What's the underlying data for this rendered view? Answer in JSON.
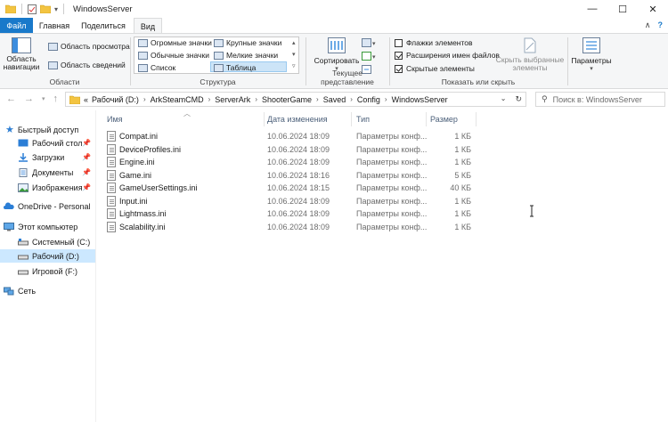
{
  "window": {
    "title": "WindowsServer",
    "controls": {
      "minimize": "—",
      "maximize": "☐",
      "close": "✕"
    }
  },
  "tabs": [
    {
      "label": "Файл"
    },
    {
      "label": "Главная"
    },
    {
      "label": "Поделиться"
    },
    {
      "label": "Вид"
    }
  ],
  "ribbon": {
    "panes": {
      "nav_pane": "Область навигации",
      "preview_pane": "Область просмотра",
      "details_pane": "Область сведений",
      "label": "Области"
    },
    "layout": {
      "label": "Структура",
      "items": [
        "Огромные значки",
        "Крупные значки",
        "Обычные значки",
        "Мелкие значки",
        "Список",
        "Таблица"
      ],
      "selected": "Таблица"
    },
    "current_view": {
      "sort": "Сортировать",
      "label": "Текущее представление"
    },
    "show_hide": {
      "label": "Показать или скрыть",
      "checkboxes": [
        {
          "label": "Флажки элементов",
          "checked": false
        },
        {
          "label": "Расширения имен файлов",
          "checked": true
        },
        {
          "label": "Скрытые элементы",
          "checked": true
        }
      ],
      "hide_selected": "Скрыть выбранные элементы"
    },
    "options": {
      "label": "Параметры"
    }
  },
  "address": {
    "prefix": "«",
    "crumbs": [
      "Рабочий (D:)",
      "ArkSteamCMD",
      "ServerArk",
      "ShooterGame",
      "Saved",
      "Config",
      "WindowsServer"
    ],
    "search_placeholder": "Поиск в: WindowsServer"
  },
  "sidebar": {
    "items": [
      {
        "label": "Быстрый доступ",
        "icon": "star-icon",
        "pinned": false
      },
      {
        "label": "Рабочий стол",
        "icon": "desktop-icon",
        "pinned": true
      },
      {
        "label": "Загрузки",
        "icon": "download-icon",
        "pinned": true
      },
      {
        "label": "Документы",
        "icon": "documents-icon",
        "pinned": true
      },
      {
        "label": "Изображения",
        "icon": "pictures-icon",
        "pinned": true
      },
      {
        "label": "OneDrive - Personal",
        "icon": "cloud-icon",
        "pinned": false
      },
      {
        "label": "Этот компьютер",
        "icon": "computer-icon",
        "pinned": false
      },
      {
        "label": "Системный (C:)",
        "icon": "drive-icon",
        "pinned": false
      },
      {
        "label": "Рабочий (D:)",
        "icon": "drive-icon",
        "pinned": false
      },
      {
        "label": "Игровой (F:)",
        "icon": "drive-icon",
        "pinned": false
      },
      {
        "label": "Сеть",
        "icon": "network-icon",
        "pinned": false
      }
    ],
    "selected_index": 8
  },
  "columns": {
    "name": "Имя",
    "date": "Дата изменения",
    "type": "Тип",
    "size": "Размер"
  },
  "files": [
    {
      "name": "Compat.ini",
      "date": "10.06.2024 18:09",
      "type": "Параметры конф...",
      "size": "1 КБ"
    },
    {
      "name": "DeviceProfiles.ini",
      "date": "10.06.2024 18:09",
      "type": "Параметры конф...",
      "size": "1 КБ"
    },
    {
      "name": "Engine.ini",
      "date": "10.06.2024 18:09",
      "type": "Параметры конф...",
      "size": "1 КБ"
    },
    {
      "name": "Game.ini",
      "date": "10.06.2024 18:16",
      "type": "Параметры конф...",
      "size": "5 КБ"
    },
    {
      "name": "GameUserSettings.ini",
      "date": "10.06.2024 18:15",
      "type": "Параметры конф...",
      "size": "40 КБ"
    },
    {
      "name": "Input.ini",
      "date": "10.06.2024 18:09",
      "type": "Параметры конф...",
      "size": "1 КБ"
    },
    {
      "name": "Lightmass.ini",
      "date": "10.06.2024 18:09",
      "type": "Параметры конф...",
      "size": "1 КБ"
    },
    {
      "name": "Scalability.ini",
      "date": "10.06.2024 18:09",
      "type": "Параметры конф...",
      "size": "1 КБ"
    }
  ],
  "colors": {
    "accent": "#1979ca",
    "selection": "#cce8ff",
    "ribbon_bg": "#f5f6f7"
  }
}
